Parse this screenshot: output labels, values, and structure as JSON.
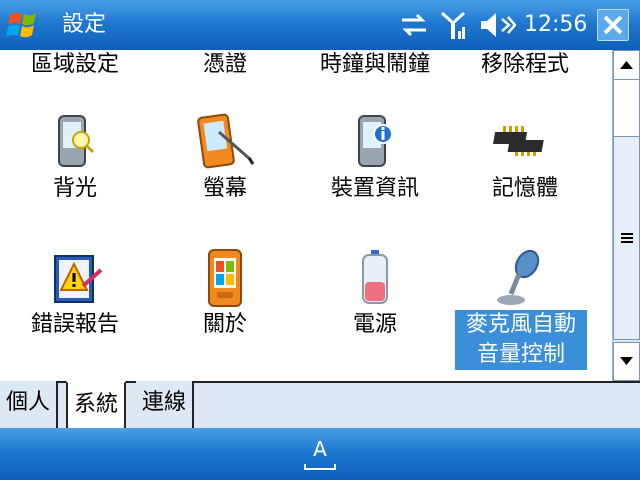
{
  "titlebar": {
    "title": "設定",
    "clock": "12:56",
    "icons": [
      "windows-start-icon",
      "sync-arrows-icon",
      "signal-antenna-icon",
      "speaker-icon",
      "close-icon"
    ]
  },
  "grid": {
    "row0": [
      "區域設定",
      "憑證",
      "時鐘與鬧鐘",
      "移除程式"
    ],
    "row1": [
      {
        "label": "背光",
        "icon": "backlight-icon"
      },
      {
        "label": "螢幕",
        "icon": "screen-icon"
      },
      {
        "label": "裝置資訊",
        "icon": "device-info-icon"
      },
      {
        "label": "記憶體",
        "icon": "memory-chip-icon"
      }
    ],
    "row2": [
      {
        "label": "錯誤報告",
        "icon": "error-report-icon"
      },
      {
        "label": "關於",
        "icon": "about-icon"
      },
      {
        "label": "電源",
        "icon": "battery-icon"
      },
      {
        "label_line1": "麥克風自動",
        "label_line2": "音量控制",
        "icon": "microphone-icon",
        "selected": true
      }
    ]
  },
  "tabs": [
    "個人",
    "系統",
    "連線"
  ],
  "active_tab": "系統",
  "sip": {
    "label": "A"
  }
}
